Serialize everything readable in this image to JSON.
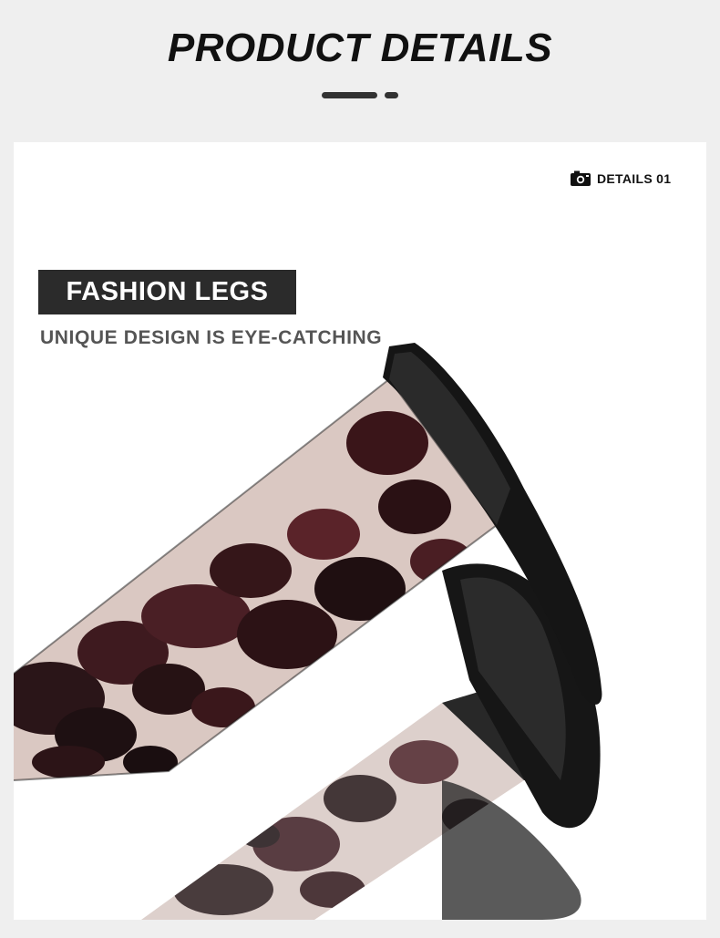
{
  "header": {
    "title": "PRODUCT DETAILS"
  },
  "card": {
    "tag": {
      "icon": "camera-icon",
      "label": "DETAILS 01"
    },
    "feature": {
      "label": "FASHION LEGS",
      "subtitle": "UNIQUE DESIGN IS EYE-CATCHING"
    },
    "photo": {
      "subject": "sunglasses-temple-arm",
      "pattern_colors": [
        "#3a1216",
        "#5a1f24",
        "#d9c6c0",
        "#1a1a1a"
      ]
    }
  }
}
